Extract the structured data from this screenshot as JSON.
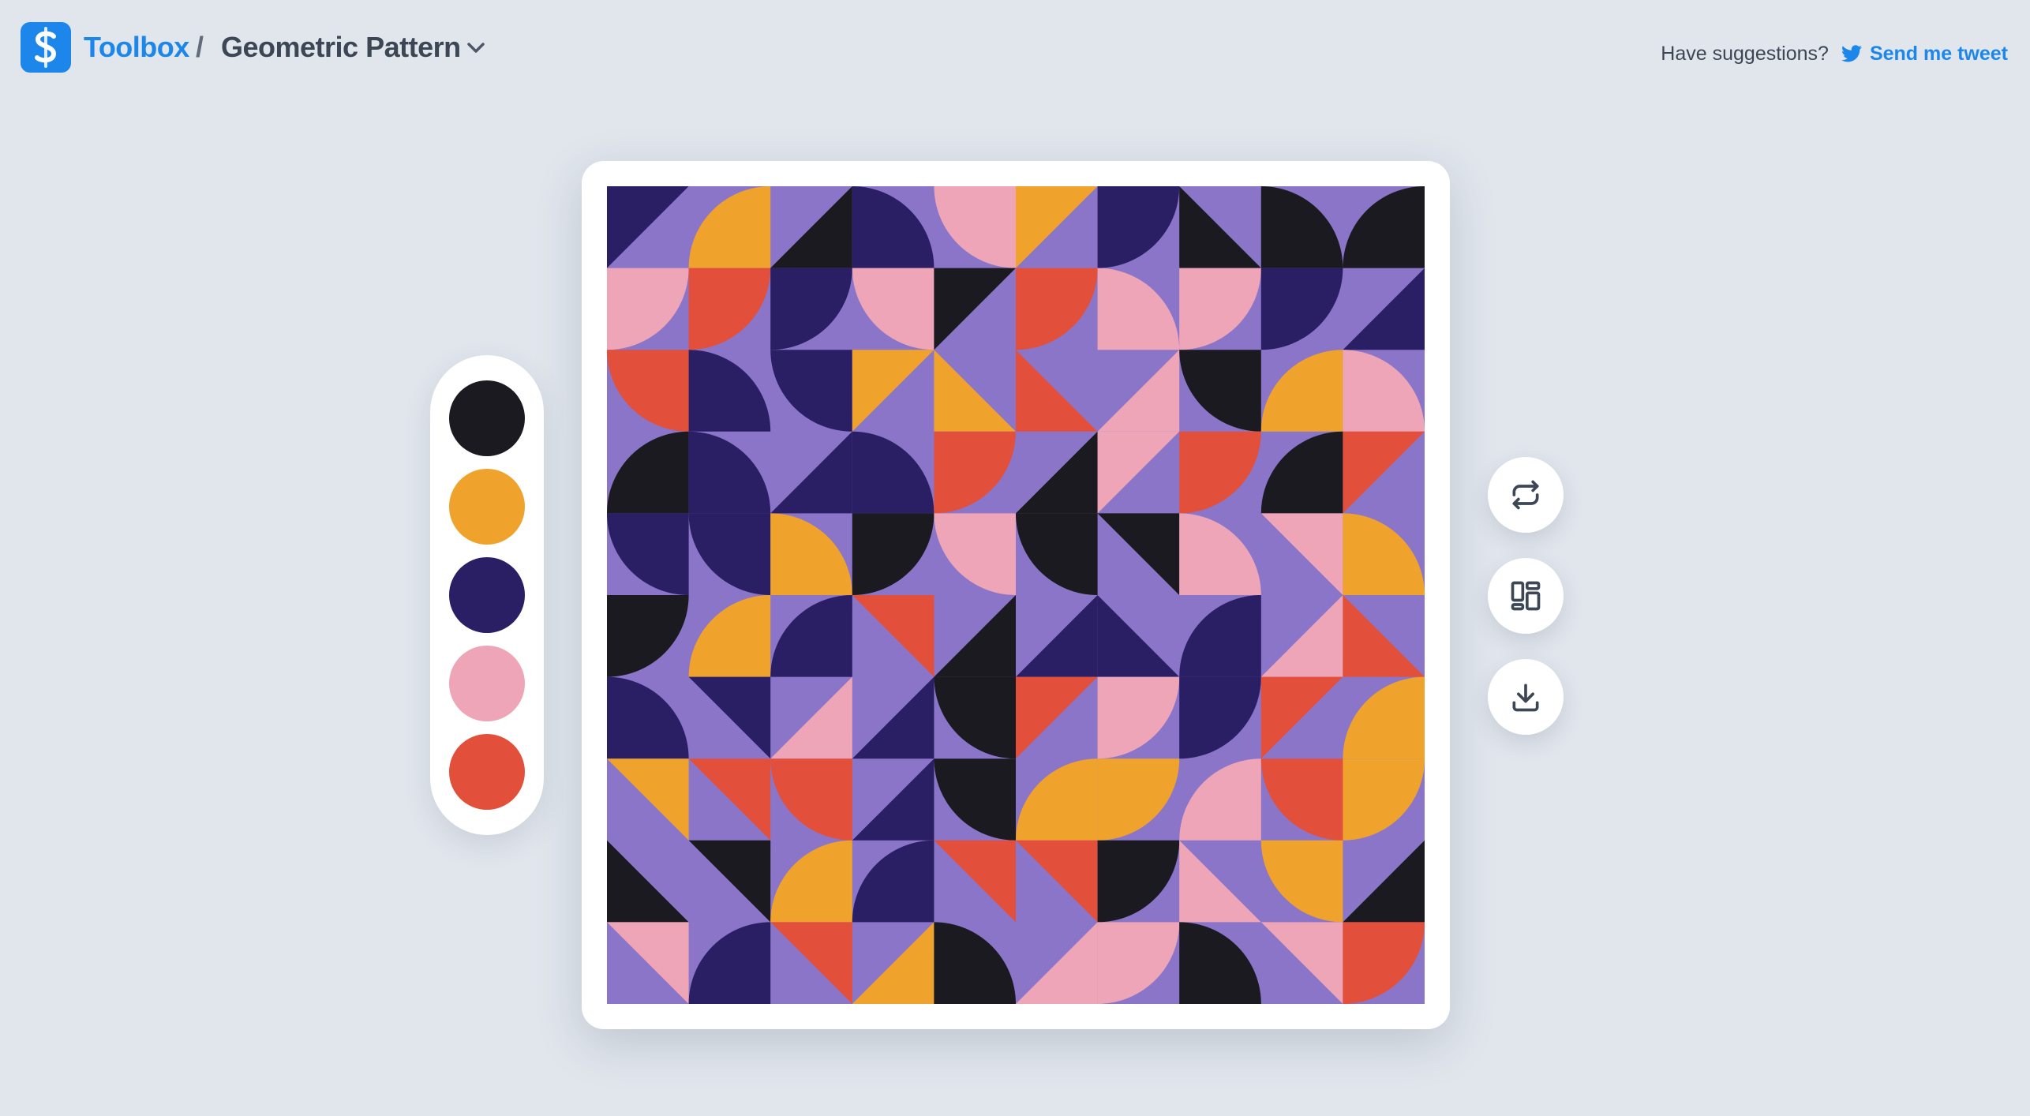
{
  "header": {
    "brand": "Toolbox",
    "separator": "/",
    "title": "Geometric Pattern",
    "suggest_text": "Have suggestions?",
    "tweet_label": "Send me tweet"
  },
  "palette": {
    "colors": [
      "#1b1a21",
      "#f0a32c",
      "#2a1e64",
      "#eda5b7",
      "#e2503c"
    ]
  },
  "pattern": {
    "rows": 10,
    "cols": 10,
    "background": "#8b75c8"
  },
  "tools": {
    "regenerate_icon": "regenerate-icon",
    "layout_icon": "layout-icon",
    "download_icon": "download-icon"
  }
}
